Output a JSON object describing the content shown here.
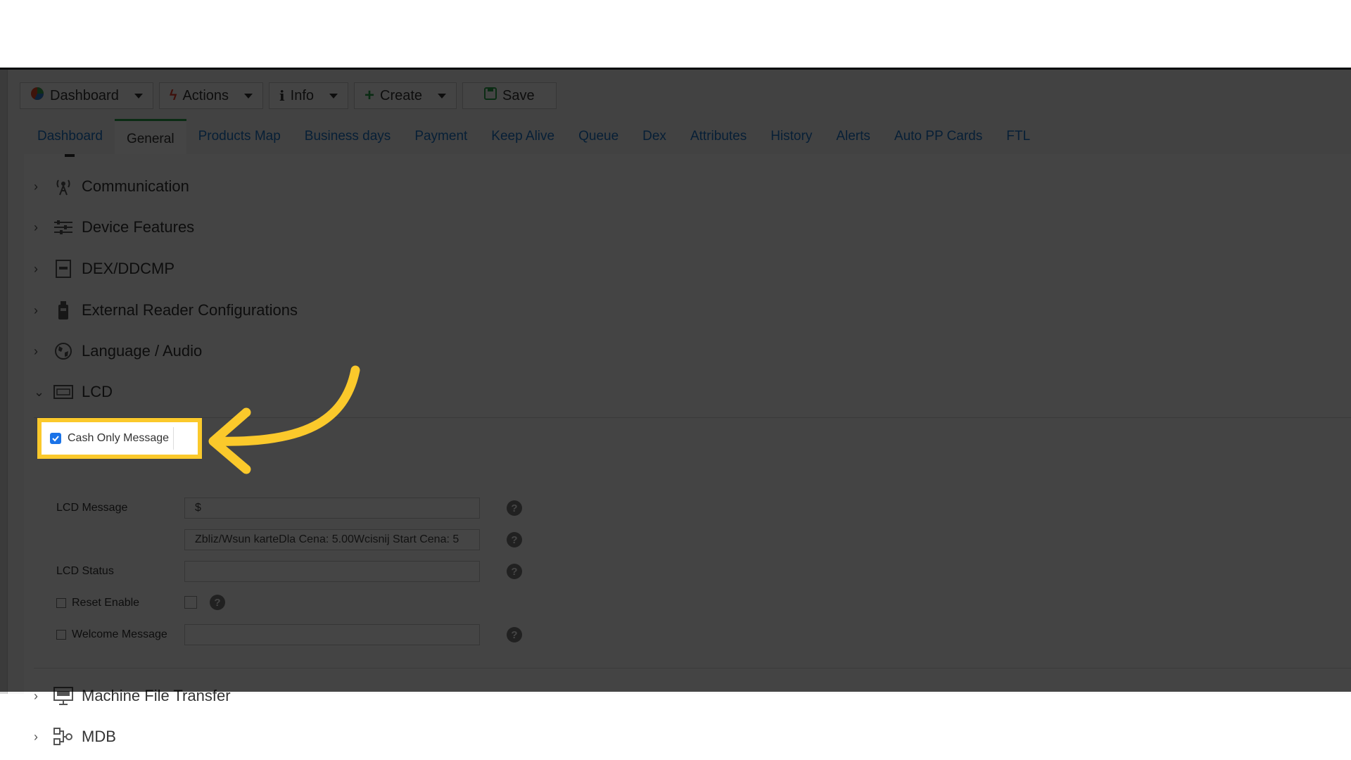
{
  "toolbar": {
    "dashboard": "Dashboard",
    "actions": "Actions",
    "info": "Info",
    "create": "Create",
    "save": "Save"
  },
  "tabs": [
    "Dashboard",
    "General",
    "Products Map",
    "Business days",
    "Payment",
    "Keep Alive",
    "Queue",
    "Dex",
    "Attributes",
    "History",
    "Alerts",
    "Auto PP Cards",
    "FTL"
  ],
  "sections": {
    "communication": "Communication",
    "device_features": "Device Features",
    "dex_ddcmp": "DEX/DDCMP",
    "external_reader": "External Reader Configurations",
    "language_audio": "Language / Audio",
    "lcd": "LCD",
    "machine_file_transfer": "Machine File Transfer",
    "mdb": "MDB"
  },
  "lcd_fields": {
    "cash_only_message": {
      "label": "Cash Only Message",
      "checked": true,
      "value": "$"
    },
    "lcd_message": {
      "label": "LCD Message",
      "value": "Zbliz/Wsun karteDla Cena:  5.00Wcisnij Start Cena:  5"
    },
    "lcd_status": {
      "label": "LCD Status",
      "value": ""
    },
    "reset_enable": {
      "label": "Reset Enable",
      "checked": false
    },
    "welcome_message": {
      "label": "Welcome Message",
      "value": ""
    }
  },
  "help_glyph": "?",
  "colors": {
    "highlight": "#fbc92b",
    "tab_active_border": "#2aa34a",
    "link": "#1a73c6",
    "overlay": "rgba(0,0,0,0.73)"
  }
}
